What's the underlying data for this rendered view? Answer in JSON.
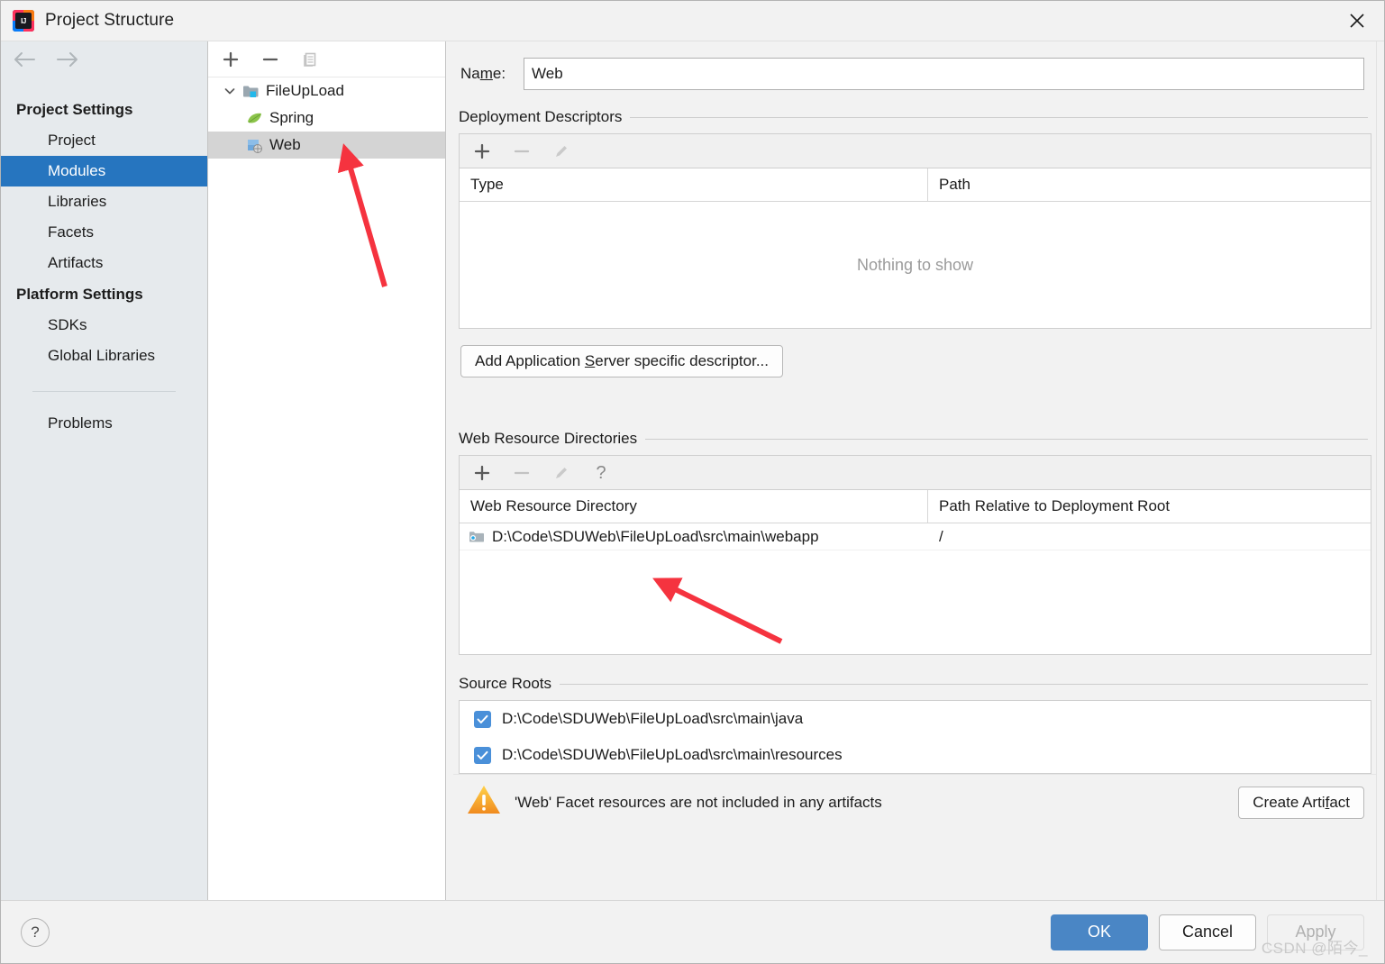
{
  "window": {
    "title": "Project Structure",
    "logo_text": "IJ",
    "close_icon": "close-icon"
  },
  "sidebar": {
    "back_icon": "arrow-left-icon",
    "forward_icon": "arrow-right-icon",
    "groups": [
      {
        "label": "Project Settings",
        "items": [
          {
            "label": "Project",
            "selected": false
          },
          {
            "label": "Modules",
            "selected": true
          },
          {
            "label": "Libraries",
            "selected": false
          },
          {
            "label": "Facets",
            "selected": false
          },
          {
            "label": "Artifacts",
            "selected": false
          }
        ]
      },
      {
        "label": "Platform Settings",
        "items": [
          {
            "label": "SDKs",
            "selected": false
          },
          {
            "label": "Global Libraries",
            "selected": false
          }
        ]
      }
    ],
    "extra_items": [
      {
        "label": "Problems",
        "selected": false
      }
    ]
  },
  "tree_panel": {
    "toolbar": [
      {
        "name": "add-module-button",
        "glyph": "+",
        "enabled": true
      },
      {
        "name": "remove-module-button",
        "glyph": "−",
        "enabled": true
      },
      {
        "name": "copy-module-button",
        "glyph": "copy-icon",
        "enabled": false
      }
    ],
    "nodes": [
      {
        "label": "FileUpLoad",
        "depth": 0,
        "icon": "module-folder-icon",
        "expanded": true,
        "selected": false
      },
      {
        "label": "Spring",
        "depth": 1,
        "icon": "spring-leaf-icon",
        "expanded": null,
        "selected": false
      },
      {
        "label": "Web",
        "depth": 1,
        "icon": "web-facet-icon",
        "expanded": null,
        "selected": true
      }
    ]
  },
  "main": {
    "name_label_pre": "Na",
    "name_label_mnemonic": "m",
    "name_label_post": "e:",
    "name_value": "Web",
    "name_placeholder": "",
    "deployment": {
      "title": "Deployment Descriptors",
      "toolbar": [
        {
          "name": "add-descriptor-button",
          "glyph": "+",
          "enabled": true
        },
        {
          "name": "remove-descriptor-button",
          "glyph": "−",
          "enabled": false
        },
        {
          "name": "edit-descriptor-button",
          "glyph": "pencil-icon",
          "enabled": false
        }
      ],
      "columns": [
        "Type",
        "Path"
      ],
      "rows": [],
      "empty_text": "Nothing to show",
      "button_pre": "Add Application ",
      "button_mnemonic": "S",
      "button_post": "erver specific descriptor..."
    },
    "web_resources": {
      "title": "Web Resource Directories",
      "toolbar": [
        {
          "name": "add-web-resource-button",
          "glyph": "+",
          "enabled": true
        },
        {
          "name": "remove-web-resource-button",
          "glyph": "−",
          "enabled": false
        },
        {
          "name": "edit-web-resource-button",
          "glyph": "pencil-icon",
          "enabled": false
        },
        {
          "name": "help-web-resource-button",
          "glyph": "?",
          "enabled": true
        }
      ],
      "columns": [
        "Web Resource Directory",
        "Path Relative to Deployment Root"
      ],
      "rows": [
        {
          "directory": "D:\\Code\\SDUWeb\\FileUpLoad\\src\\main\\webapp",
          "relative_path": "/",
          "icon": "folder-web-icon"
        }
      ]
    },
    "source_roots": {
      "title": "Source Roots",
      "items": [
        {
          "path": "D:\\Code\\SDUWeb\\FileUpLoad\\src\\main\\java",
          "checked": true
        },
        {
          "path": "D:\\Code\\SDUWeb\\FileUpLoad\\src\\main\\resources",
          "checked": true
        }
      ]
    },
    "warning": {
      "icon": "warning-triangle-icon",
      "text": "'Web' Facet resources are not included in any artifacts",
      "action_pre": "Create Arti",
      "action_mnemonic": "f",
      "action_post": "act"
    }
  },
  "footer": {
    "help_label": "?",
    "ok_label": "OK",
    "cancel_label": "Cancel",
    "apply_label": "Apply"
  },
  "watermark": "CSDN @陌今_",
  "colors": {
    "accent_selected": "#2675bf",
    "primary_button": "#4a86c5",
    "sidebar_bg": "#e6eaed",
    "dialog_bg": "#f2f2f2",
    "tree_selected": "#d4d4d4",
    "checkbox": "#4a90d9",
    "annotation_arrow": "#f5333f",
    "warning_icon": "#f5a623"
  }
}
